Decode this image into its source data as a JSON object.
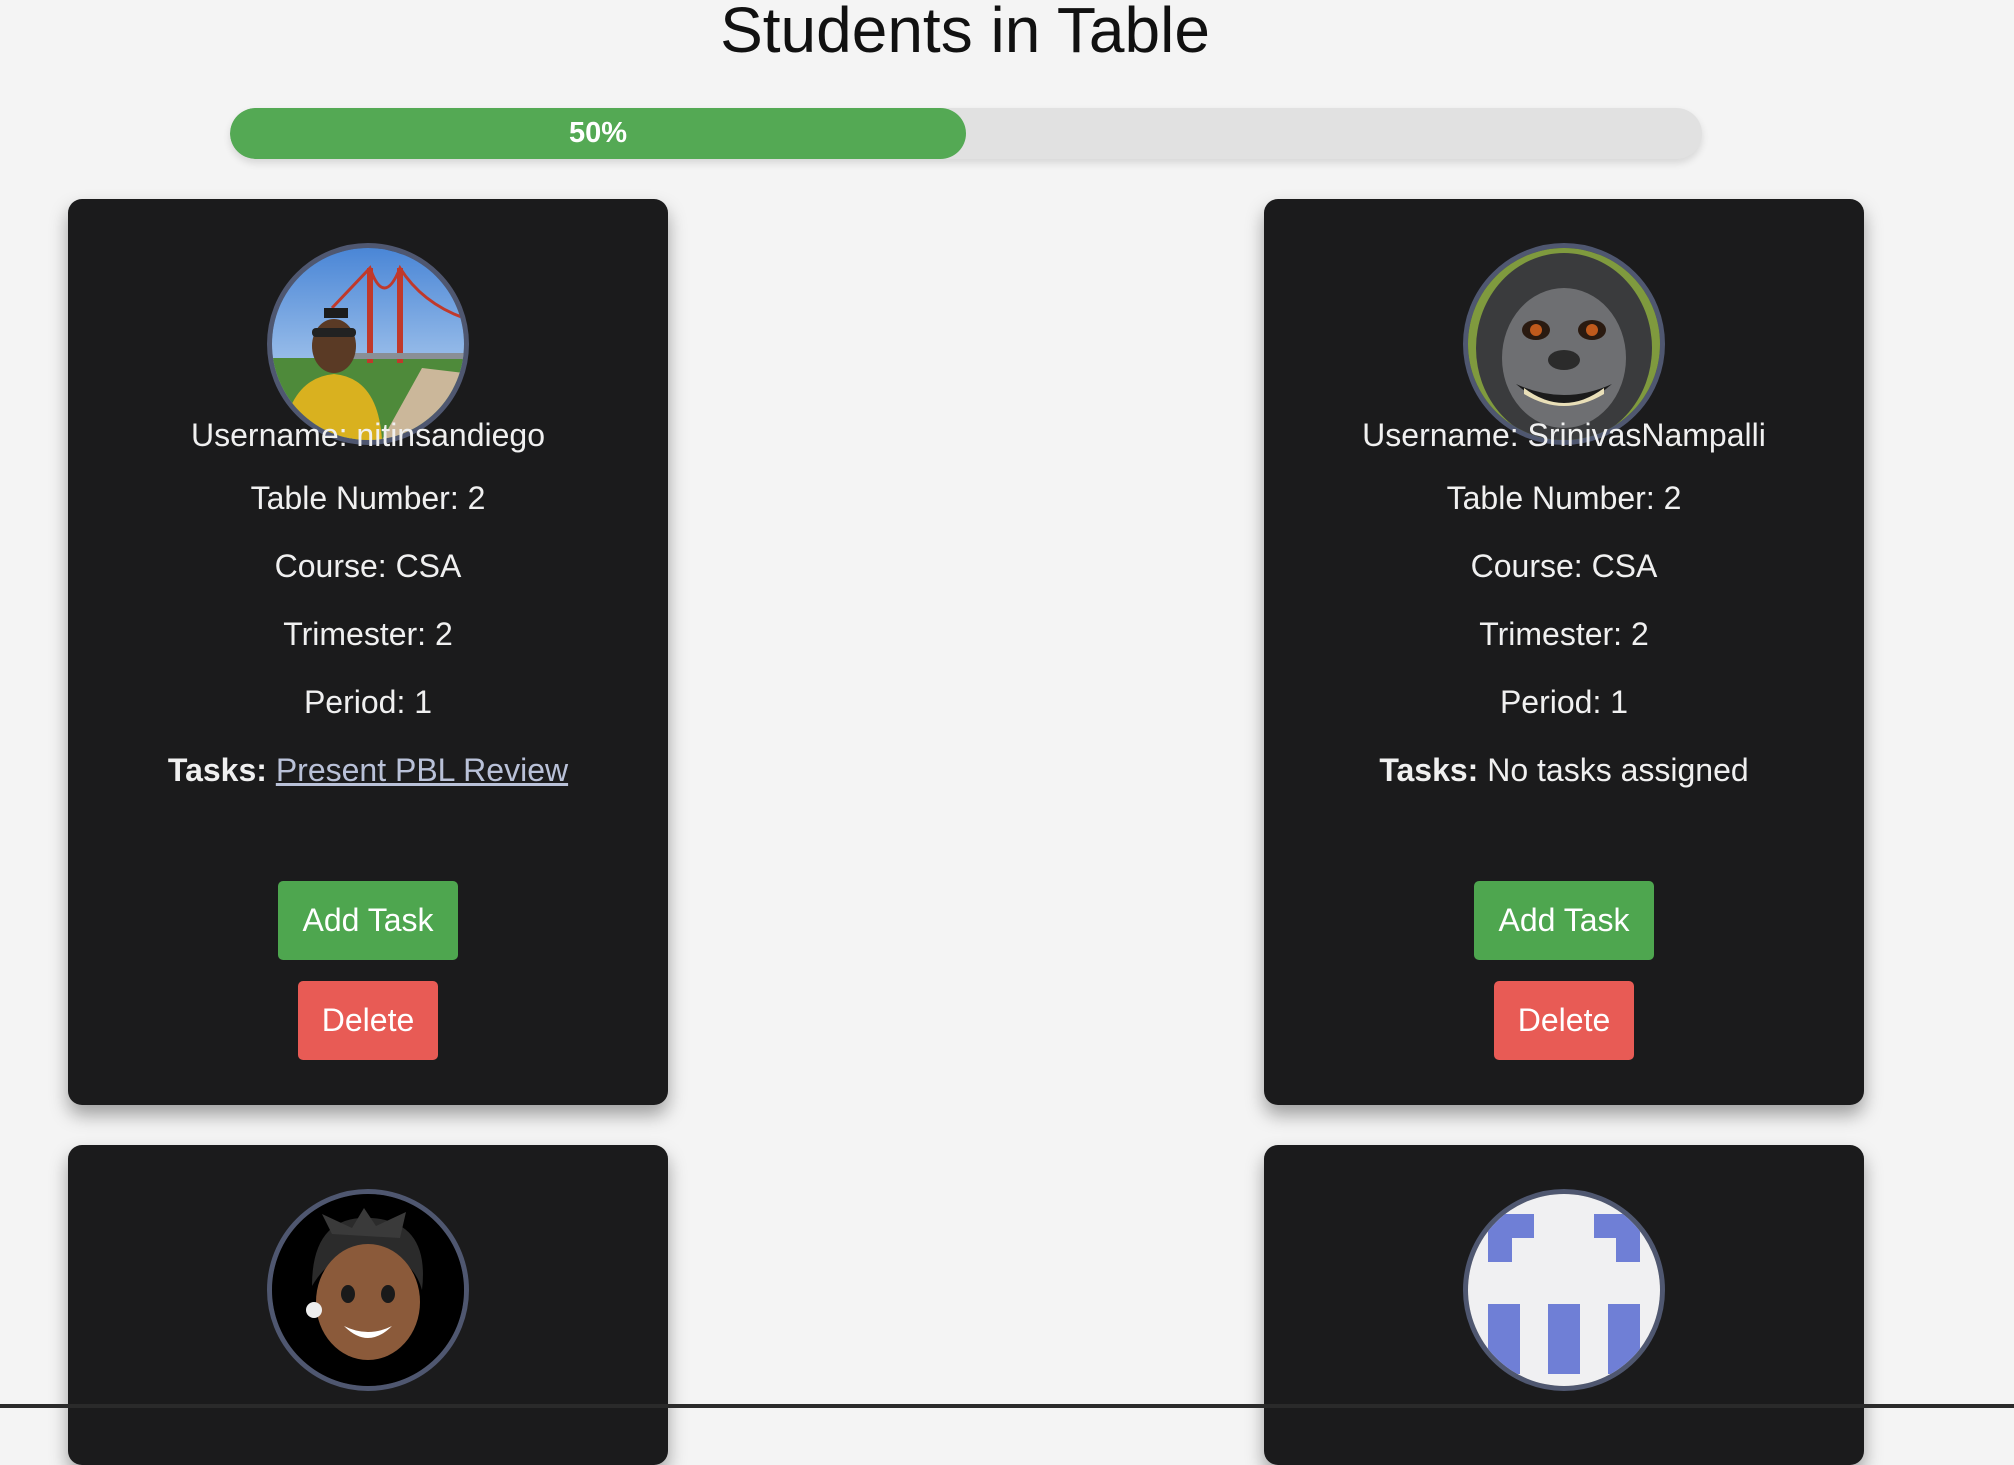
{
  "page": {
    "title": "Students in Table"
  },
  "progress": {
    "value_percent": 50,
    "label": "50%",
    "fill_color": "#54a954",
    "track_color": "#e1e1e1"
  },
  "labels": {
    "username": "Username: ",
    "table_number": "Table Number: ",
    "course": "Course: ",
    "trimester": "Trimester: ",
    "period": "Period: ",
    "tasks": "Tasks:"
  },
  "buttons": {
    "add_task": "Add Task",
    "delete": "Delete"
  },
  "students": [
    {
      "username": "nitinsandiego",
      "table_number": "2",
      "course": "CSA",
      "trimester": "2",
      "period": "1",
      "tasks_text": "Present PBL Review",
      "tasks_is_link": true,
      "avatar_icon": "person-golden-gate-photo-icon"
    },
    {
      "username": "SrinivasNampalli",
      "table_number": "2",
      "course": "CSA",
      "trimester": "2",
      "period": "1",
      "tasks_text": "No tasks assigned",
      "tasks_is_link": false,
      "avatar_icon": "monkey-photo-icon"
    },
    {
      "avatar_icon": "memoji-avatar-icon"
    },
    {
      "avatar_icon": "identicon-avatar-icon"
    }
  ],
  "colors": {
    "card_background": "#1b1b1c",
    "avatar_border": "#4f5770",
    "add_button": "#4ea64f",
    "delete_button": "#e85b55",
    "page_background": "#f4f4f4"
  }
}
